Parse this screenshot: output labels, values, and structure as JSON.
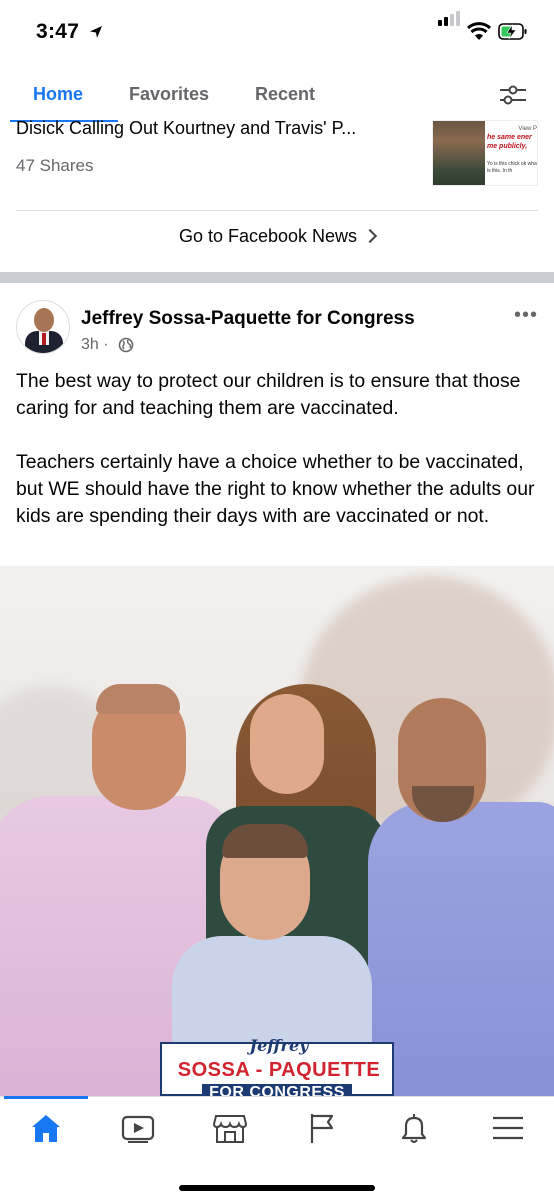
{
  "status_bar": {
    "time": "3:47"
  },
  "tabs": {
    "home": "Home",
    "favorites": "Favorites",
    "recent": "Recent"
  },
  "news_story": {
    "headline": "Disick Calling Out Kourtney and Travis' P...",
    "shares": "47 Shares",
    "thumb_view": "View P",
    "thumb_red": "he same ener me publicly,",
    "thumb_small": "Yo is this chick ok what is this. In th"
  },
  "go_to_news": "Go to Facebook News",
  "post": {
    "author": "Jeffrey Sossa-Paquette for Congress",
    "time": "3h ·",
    "paragraphs": [
      "The best way to protect our children is to ensure that those caring for and teaching them are vaccinated.",
      "Teachers certainly have a choice whether to be vaccinated, but WE should have the right to know whether the adults our kids are spending their days with are vaccinated or not."
    ],
    "banner": {
      "first_name": "Jeffrey",
      "last_name": "SOSSA - PAQUETTE",
      "subtitle": "FOR CONGRESS"
    }
  },
  "colors": {
    "accent": "#1877f2",
    "secondary_text": "#65676b",
    "banner_blue": "#1d3b73",
    "banner_red": "#d1242f"
  },
  "bottom_nav": {
    "icons": [
      "home-icon",
      "video-icon",
      "marketplace-icon",
      "pages-flag-icon",
      "notifications-bell-icon",
      "menu-icon"
    ]
  }
}
